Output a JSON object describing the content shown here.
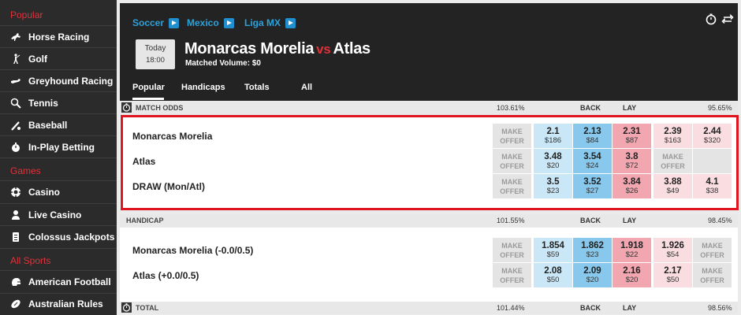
{
  "sidebar": {
    "sections": [
      {
        "label": "Popular"
      },
      {
        "label": "Games"
      },
      {
        "label": "All Sports"
      }
    ],
    "items": [
      {
        "label": "Horse Racing",
        "icon": "horse-icon"
      },
      {
        "label": "Golf",
        "icon": "golfer-icon"
      },
      {
        "label": "Greyhound Racing",
        "icon": "greyhound-icon"
      },
      {
        "label": "Tennis",
        "icon": "tennis-icon"
      },
      {
        "label": "Baseball",
        "icon": "baseball-icon"
      },
      {
        "label": "In-Play Betting",
        "icon": "stopwatch-icon"
      },
      {
        "label": "Casino",
        "icon": "casino-chip-icon"
      },
      {
        "label": "Live Casino",
        "icon": "dealer-icon"
      },
      {
        "label": "Colossus Jackpots",
        "icon": "ticket-icon"
      },
      {
        "label": "American Football",
        "icon": "helmet-icon"
      },
      {
        "label": "Australian Rules",
        "icon": "rugby-ball-icon"
      }
    ]
  },
  "breadcrumb": [
    "Soccer",
    "Mexico",
    "Liga MX"
  ],
  "event": {
    "day": "Today",
    "time": "18:00",
    "home": "Monarcas Morelia",
    "vs": "vs",
    "away": "Atlas",
    "matched_volume": "Matched Volume: $0"
  },
  "tabs": [
    "Popular",
    "Handicaps",
    "Totals",
    "All"
  ],
  "markets": [
    {
      "name": "MATCH ODDS",
      "back_pct": "103.61%",
      "back_label": "BACK",
      "lay_label": "LAY",
      "lay_pct": "95.65%",
      "runners": [
        {
          "name": "Monarcas Morelia",
          "cells": [
            {
              "t": "mo"
            },
            {
              "t": "back-light",
              "o": "2.1",
              "s": "$186"
            },
            {
              "t": "back-main",
              "o": "2.13",
              "s": "$84"
            },
            {
              "t": "lay-main",
              "o": "2.31",
              "s": "$87"
            },
            {
              "t": "lay-light",
              "o": "2.39",
              "s": "$163"
            },
            {
              "t": "lay-light",
              "o": "2.44",
              "s": "$320"
            }
          ]
        },
        {
          "name": "Atlas",
          "cells": [
            {
              "t": "mo"
            },
            {
              "t": "back-light",
              "o": "3.48",
              "s": "$20"
            },
            {
              "t": "back-main",
              "o": "3.54",
              "s": "$24"
            },
            {
              "t": "lay-main",
              "o": "3.8",
              "s": "$72"
            },
            {
              "t": "mo"
            },
            {
              "t": "empty"
            }
          ]
        },
        {
          "name": "DRAW (Mon/Atl)",
          "cells": [
            {
              "t": "mo"
            },
            {
              "t": "back-light",
              "o": "3.5",
              "s": "$23"
            },
            {
              "t": "back-main",
              "o": "3.52",
              "s": "$27"
            },
            {
              "t": "lay-main",
              "o": "3.84",
              "s": "$26"
            },
            {
              "t": "lay-light",
              "o": "3.88",
              "s": "$49"
            },
            {
              "t": "lay-light",
              "o": "4.1",
              "s": "$38"
            }
          ]
        }
      ]
    },
    {
      "name": "HANDICAP",
      "back_pct": "101.55%",
      "back_label": "BACK",
      "lay_label": "LAY",
      "lay_pct": "98.45%",
      "runners": [
        {
          "name": "Monarcas Morelia (-0.0/0.5)",
          "cells": [
            {
              "t": "mo"
            },
            {
              "t": "back-light",
              "o": "1.854",
              "s": "$59"
            },
            {
              "t": "back-main",
              "o": "1.862",
              "s": "$23"
            },
            {
              "t": "lay-main",
              "o": "1.918",
              "s": "$22"
            },
            {
              "t": "lay-light",
              "o": "1.926",
              "s": "$54"
            },
            {
              "t": "mo"
            }
          ]
        },
        {
          "name": "Atlas (+0.0/0.5)",
          "cells": [
            {
              "t": "mo"
            },
            {
              "t": "back-light",
              "o": "2.08",
              "s": "$50"
            },
            {
              "t": "back-main",
              "o": "2.09",
              "s": "$20"
            },
            {
              "t": "lay-main",
              "o": "2.16",
              "s": "$20"
            },
            {
              "t": "lay-light",
              "o": "2.17",
              "s": "$50"
            },
            {
              "t": "mo"
            }
          ]
        }
      ]
    },
    {
      "name": "TOTAL",
      "back_pct": "101.44%",
      "back_label": "BACK",
      "lay_label": "LAY",
      "lay_pct": "98.56%",
      "runners": []
    }
  ],
  "make_offer_line1": "MAKE",
  "make_offer_line2": "OFFER",
  "colors": {
    "accent_red": "#e0313a",
    "link_blue": "#2ba2dc",
    "back": "#87c8ec",
    "lay": "#f2a6b0"
  }
}
